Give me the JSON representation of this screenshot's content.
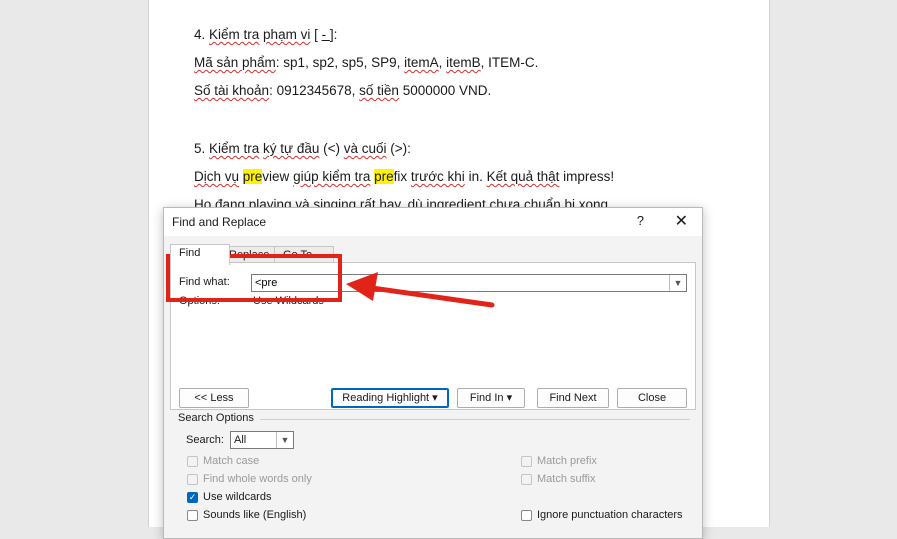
{
  "document": {
    "line1": {
      "prefix": "4. ",
      "a": "Kiểm tra",
      "b": " ",
      "c": "phạm vi",
      "d": " [ ",
      "e": "- ",
      "f": "]:"
    },
    "line2": {
      "a": "Mã sản phẩm",
      "b": ": sp1, sp2, sp5, SP9, ",
      "c": "itemA",
      "d": ", ",
      "e": "itemB",
      "f": ", ITEM-C."
    },
    "line3": {
      "a": "Số tài khoản",
      "b": ": 0912345678, ",
      "c": "số tiền",
      "d": " 5000000 VND."
    },
    "line4": {
      "a": "5. ",
      "b": "Kiểm tra",
      "c": " ",
      "d": "ký tự đầu",
      "e": " (<) ",
      "f": "và cuối",
      "g": " (>):"
    },
    "line5": {
      "a": "Dịch vụ",
      "b": " ",
      "c": "pre",
      "d": "view ",
      "e": "giúp kiểm tra",
      "f": " ",
      "g": "pre",
      "h": "fix ",
      "i": "trước khi",
      "j": " in. ",
      "k": "Kết quả thật",
      "l": " impress!"
    },
    "line6": "Họ đang playing và singing rất hay, dù ingredient chưa chuẩn bị xong."
  },
  "dialog": {
    "title": "Find and Replace",
    "help": "?",
    "close": "✕",
    "tabs": [
      "Find",
      "Replace",
      "Go To"
    ],
    "find_what_label": "Find what:",
    "find_what_value": "<pre",
    "options_label": "Options:",
    "options_value": "Use Wildcards",
    "less_button": "<< Less",
    "reading_highlight_button": "Reading Highlight ▾",
    "find_in_button": "Find In ▾",
    "find_next_button": "Find Next",
    "close_button": "Close",
    "search_options_title": "Search Options",
    "search_label": "Search:",
    "search_value": "All",
    "checkboxes_left": [
      {
        "label": "Match case",
        "checked": false,
        "disabled": true
      },
      {
        "label": "Find whole words only",
        "checked": false,
        "disabled": true
      },
      {
        "label": "Use wildcards",
        "checked": true,
        "disabled": false
      },
      {
        "label": "Sounds like (English)",
        "checked": false,
        "disabled": false
      }
    ],
    "checkboxes_right": [
      {
        "label": "Match prefix",
        "checked": false,
        "disabled": true
      },
      {
        "label": "Match suffix",
        "checked": false,
        "disabled": true
      },
      {
        "label": "Ignore punctuation characters",
        "checked": false,
        "disabled": false
      }
    ]
  },
  "colors": {
    "annotation": "#e2231a",
    "highlight": "#fff200",
    "accent": "#0067c0"
  }
}
